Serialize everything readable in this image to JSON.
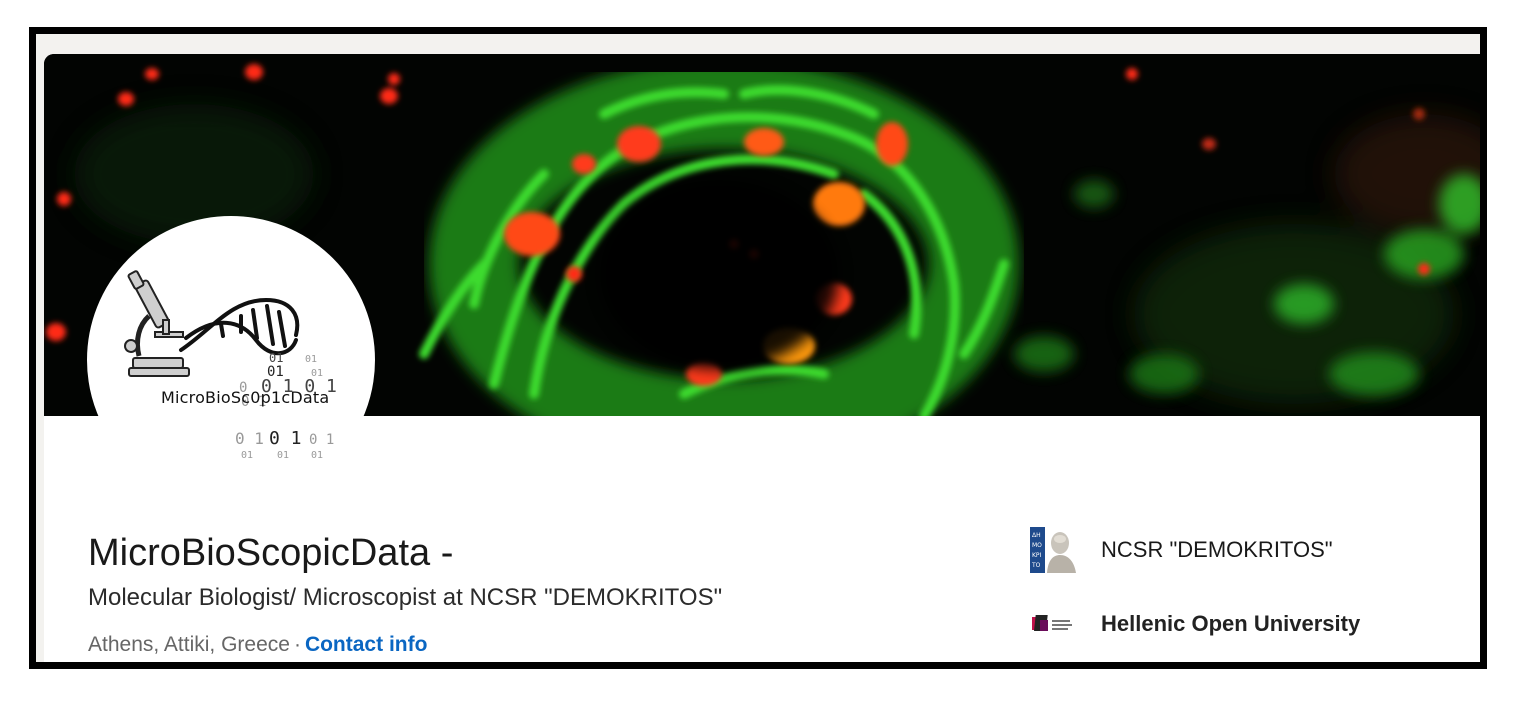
{
  "profile": {
    "name": "MicroBioScopicData -",
    "headline": "Molecular Biologist/ Microscopist at NCSR \"DEMOKRITOS\"",
    "location": "Athens, Attiki, Greece",
    "separator": "·",
    "contact_label": "Contact info",
    "avatar_logo_text": "MicroBioSc0p1cData"
  },
  "organizations": [
    {
      "name": "NCSR \"DEMOKRITOS\"",
      "icon": "demokritos-logo-icon"
    },
    {
      "name": "Hellenic Open University",
      "icon": "hellenic-open-university-logo-icon"
    }
  ],
  "colors": {
    "link": "#0a66c2",
    "banner_bg": "#020402",
    "mito_green": "#2fd12a",
    "spot_red": "#ff3b1a"
  }
}
